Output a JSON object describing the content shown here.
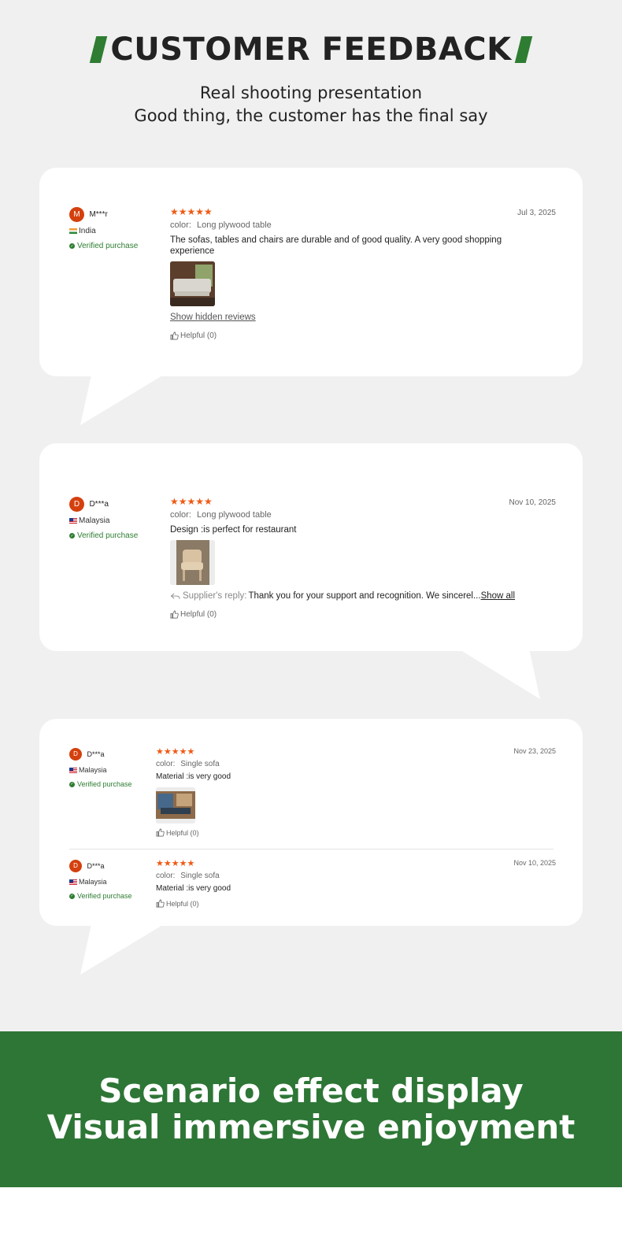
{
  "header": {
    "title": "CUSTOMER FEEDBACK",
    "subtitle_line1": "Real shooting presentation",
    "subtitle_line2": "Good thing, the customer has the final say"
  },
  "colors": {
    "accent": "#2e7d32",
    "star": "#f05a14",
    "avatar": "#d4400e",
    "banner": "#2e7636"
  },
  "reviews": [
    {
      "avatar_letter": "M",
      "name": "M***r",
      "country": "India",
      "verified": "Verified purchase",
      "stars": "★★★★★",
      "rating": 5,
      "date": "Jul 3, 2025",
      "color_label": "color:",
      "color_value": "Long plywood table",
      "text": "The sofas, tables and chairs are durable and of good quality. A very good shopping experience",
      "show_hidden": "Show hidden reviews",
      "helpful": "Helpful (0)"
    },
    {
      "avatar_letter": "D",
      "name": "D***a",
      "country": "Malaysia",
      "verified": "Verified purchase",
      "stars": "★★★★★",
      "rating": 5,
      "date": "Nov 10, 2025",
      "color_label": "color:",
      "color_value": "Long plywood table",
      "text": "Design :is perfect for restaurant",
      "reply_label": "Supplier's reply:",
      "reply_text": "Thank you for your support and recognition. We sincerel...",
      "reply_show": "Show all",
      "helpful": "Helpful (0)"
    },
    {
      "avatar_letter": "D",
      "name": "D***a",
      "country": "Malaysia",
      "verified": "Verified purchase",
      "stars": "★★★★★",
      "rating": 5,
      "date": "Nov 23, 2025",
      "color_label": "color:",
      "color_value": "Single sofa",
      "text": "Material :is very good",
      "helpful": "Helpful (0)"
    },
    {
      "avatar_letter": "D",
      "name": "D***a",
      "country": "Malaysia",
      "verified": "Verified purchase",
      "stars": "★★★★★",
      "rating": 5,
      "date": "Nov 10, 2025",
      "color_label": "color:",
      "color_value": "Single sofa",
      "text": "Material :is very good",
      "helpful": "Helpful (0)"
    }
  ],
  "banner": {
    "line1": "Scenario effect display",
    "line2": "Visual immersive enjoyment"
  }
}
